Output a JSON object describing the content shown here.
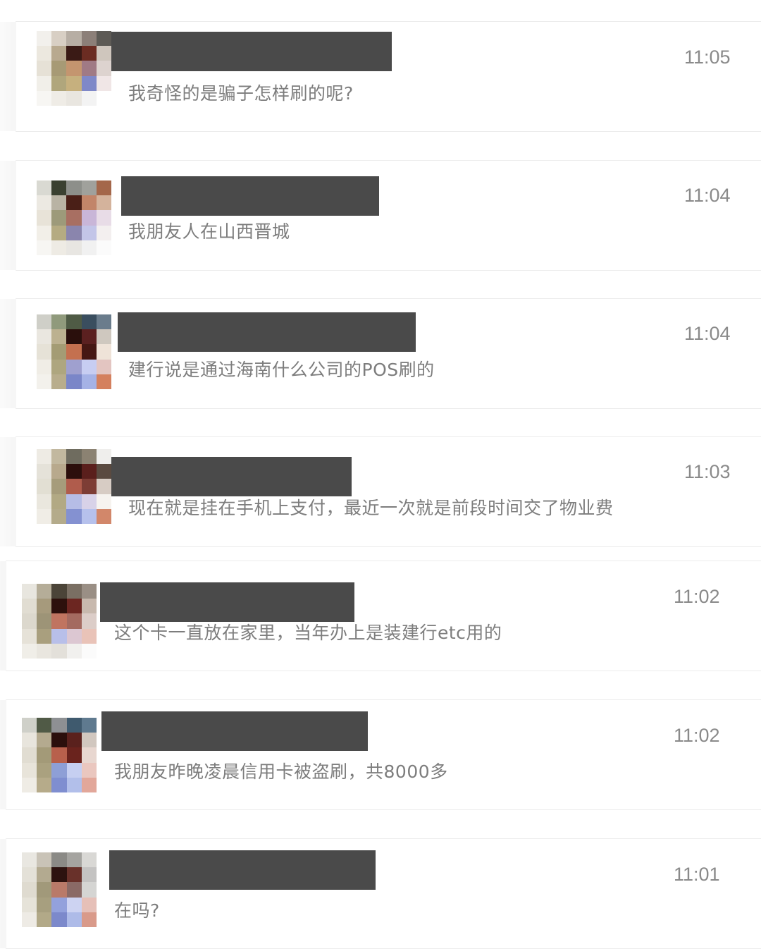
{
  "chat_list": {
    "items": [
      {
        "time": "11:05",
        "message": "我奇怪的是骗子怎样刷的呢?"
      },
      {
        "time": "11:04",
        "message": "我朋友人在山西晋城"
      },
      {
        "time": "11:04",
        "message": "建行说是通过海南什么公司的POS刷的"
      },
      {
        "time": "11:03",
        "message": "现在就是挂在手机上支付，最近一次就是前段时间交了物业费"
      },
      {
        "time": "11:02",
        "message": "这个卡一直放在家里，当年办上是装建行etc用的"
      },
      {
        "time": "11:02",
        "message": "我朋友昨晚凌晨信用卡被盗刷，共8000多"
      },
      {
        "time": "11:01",
        "message": "在吗?"
      }
    ]
  },
  "avatar_palettes": [
    [
      "#f2f0ec",
      "#d8cfc4",
      "#b7aea4",
      "#8c7f78",
      "#5d5a55",
      "#ece8df",
      "#b8a98f",
      "#3a1a15",
      "#6b2c22",
      "#cfc6bd",
      "#e6e1d6",
      "#a79a75",
      "#c4956f",
      "#a07a85",
      "#ddd3cf",
      "#f1efe9",
      "#b0a67c",
      "#c6b07e",
      "#7f88c8",
      "#f0e6e6",
      "#f7f6f3",
      "#efece6",
      "#e9e6e0",
      "#f3f3f3",
      "#ffffff"
    ],
    [
      "#d9d9d2",
      "#3a4030",
      "#8d8f8a",
      "#a0a19c",
      "#a4674a",
      "#ece9e2",
      "#b9b3a4",
      "#4a1f17",
      "#c28569",
      "#d4b39c",
      "#e8e3d8",
      "#9d9a7a",
      "#a86f62",
      "#c9b6d8",
      "#e8dce7",
      "#f2efe8",
      "#b5ab82",
      "#8a85ad",
      "#c3c5e8",
      "#f3efef",
      "#f7f6f3",
      "#eeebe4",
      "#e8e6e2",
      "#f1f1f1",
      "#fbfbfb"
    ],
    [
      "#cfcfc8",
      "#909a7c",
      "#4f5b45",
      "#3a4e5f",
      "#6a7c8c",
      "#eae7e0",
      "#bcb190",
      "#2a0f0c",
      "#5b2020",
      "#cfc8bf",
      "#e6e2d7",
      "#a49c74",
      "#c4704f",
      "#451713",
      "#efe3d8",
      "#f0ede6",
      "#aea67f",
      "#9fa0cf",
      "#c7cdf2",
      "#e3c5c1",
      "#f3f1ec",
      "#b8ad8c",
      "#7a86c8",
      "#a5b2e6",
      "#d4805e"
    ],
    [
      "#eeebe4",
      "#c2b89f",
      "#6f6c5f",
      "#8b8272",
      "#efeeec",
      "#e5e2d9",
      "#b8a98d",
      "#2c0f0c",
      "#5a1f1c",
      "#5a4a40",
      "#e2dfd3",
      "#a69c7b",
      "#b05c4c",
      "#7d3d35",
      "#d7ccc4",
      "#eae7de",
      "#b2a984",
      "#b6bde6",
      "#d8d2e8",
      "#f6f3ef",
      "#f0ede6",
      "#b4ab8b",
      "#8491d1",
      "#b6c1ec",
      "#d2876a"
    ],
    [
      "#e8e6df",
      "#b5ad98",
      "#4b4438",
      "#7a6f63",
      "#9a8f85",
      "#e1ddd2",
      "#a69a7c",
      "#2d100c",
      "#6c2621",
      "#c8b9ae",
      "#dcd8cd",
      "#9d9477",
      "#c07460",
      "#a46a60",
      "#dccdc8",
      "#e6e2d8",
      "#a99f7e",
      "#b8bfe9",
      "#dcc7d2",
      "#e9c3b8",
      "#f0eee8",
      "#e9e6df",
      "#e3e0da",
      "#f1f0ee",
      "#fbfbfb"
    ],
    [
      "#cfd0c9",
      "#505a46",
      "#8e9093",
      "#3f5a6e",
      "#5f7a8f",
      "#e8e5dd",
      "#b4aa8f",
      "#2b0f0c",
      "#5a211d",
      "#d1c7bf",
      "#e1ddd2",
      "#a39a78",
      "#b8604c",
      "#6a231d",
      "#e8d7d0",
      "#e8e4da",
      "#aaa17f",
      "#8e9fd6",
      "#c6cff1",
      "#eac7bf",
      "#efece5",
      "#b6ab8a",
      "#7f8ed0",
      "#b2bfea",
      "#e2a79a"
    ],
    [
      "#e9e7e1",
      "#c9c3b7",
      "#8b8a86",
      "#a5a4a0",
      "#d9d8d5",
      "#e4e1d8",
      "#b3aa90",
      "#2d120f",
      "#69312a",
      "#c4c3c2",
      "#dfdbd0",
      "#a1997a",
      "#b97a69",
      "#8a6a66",
      "#d5d5d3",
      "#e6e3d9",
      "#a79f7f",
      "#93a1dc",
      "#cdd3f2",
      "#e6c0b8",
      "#eeebe5",
      "#b2a988",
      "#7c89cb",
      "#aebbe8",
      "#d99a8a"
    ]
  ]
}
